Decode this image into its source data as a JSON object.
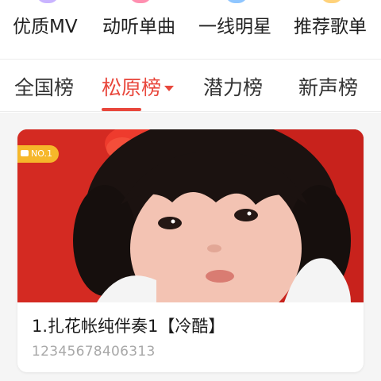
{
  "quick_nav": {
    "items": [
      {
        "label": "优质MV",
        "dot_color": "#c9b4ff"
      },
      {
        "label": "动听单曲",
        "dot_color": "#ff8fb0"
      },
      {
        "label": "一线明星",
        "dot_color": "#8fc6ff"
      },
      {
        "label": "推荐歌单",
        "dot_color": "#ffd27a"
      }
    ]
  },
  "rank_tabs": {
    "active_index": 1,
    "items": [
      {
        "label": "全国榜"
      },
      {
        "label": "松原榜"
      },
      {
        "label": "潜力榜"
      },
      {
        "label": "新声榜"
      }
    ]
  },
  "card": {
    "badge": "NO.1",
    "title": "1.扎花帐纯伴奏1【冷酷】",
    "subtitle": "12345678406313"
  },
  "colors": {
    "accent": "#e8473c",
    "badge": "#f6b72a",
    "cover_bg": "#d5261f"
  },
  "icons": {
    "dropdown": "caret-down-icon",
    "badge": "camera-icon"
  }
}
